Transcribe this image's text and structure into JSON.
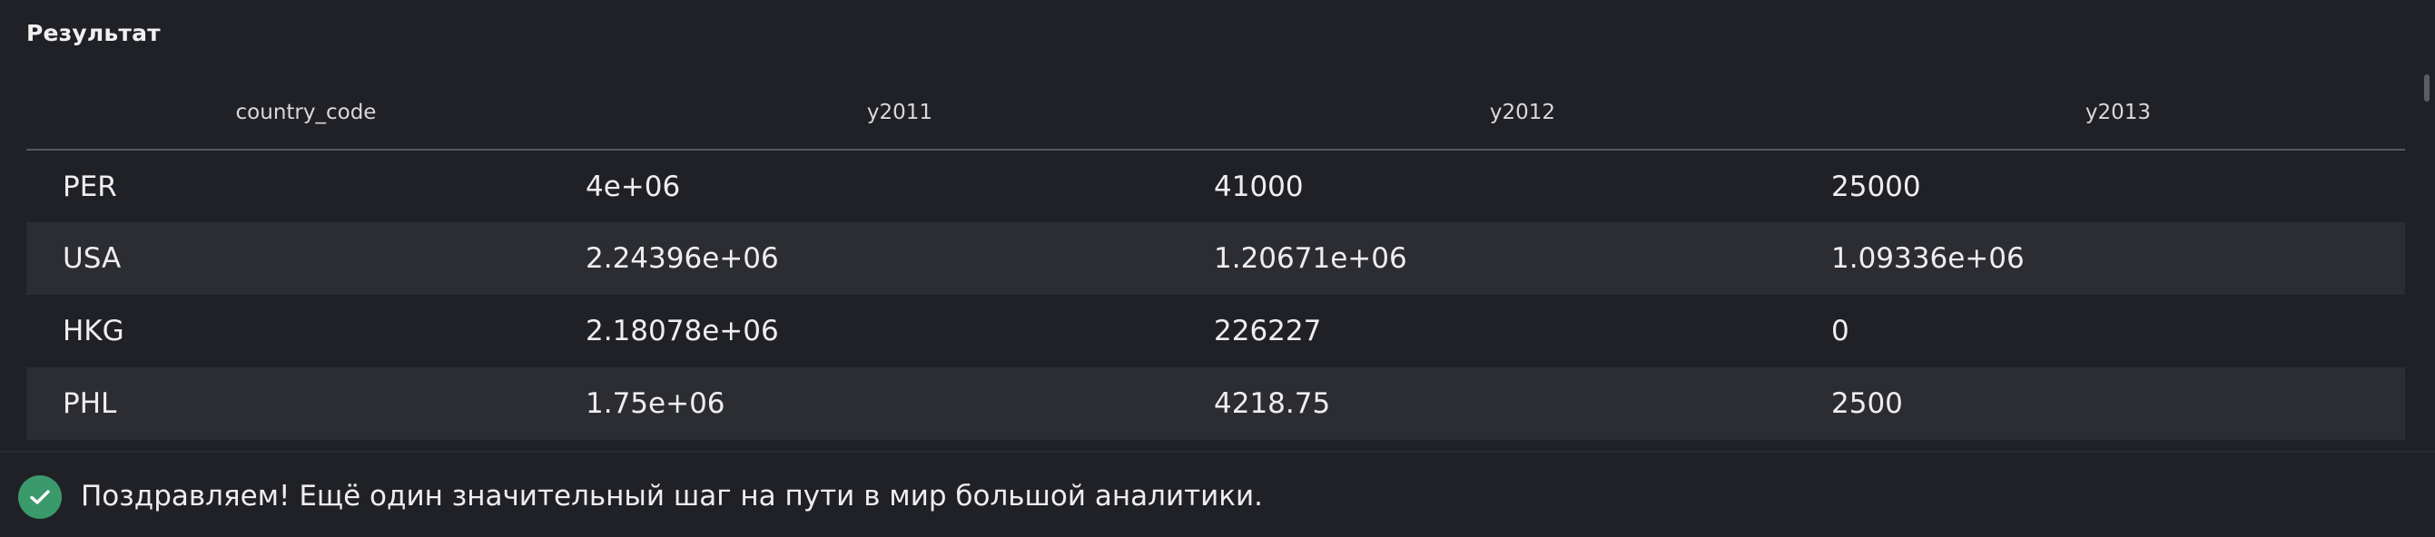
{
  "result": {
    "title": "Результат",
    "columns": [
      "country_code",
      "y2011",
      "y2012",
      "y2013"
    ],
    "rows": [
      [
        "PER",
        "4e+06",
        "41000",
        "25000"
      ],
      [
        "USA",
        "2.24396e+06",
        "1.20671e+06",
        "1.09336e+06"
      ],
      [
        "HKG",
        "2.18078e+06",
        "226227",
        "0"
      ],
      [
        "PHL",
        "1.75e+06",
        "4218.75",
        "2500"
      ]
    ]
  },
  "status": {
    "icon": "check-circle-icon",
    "message": "Поздравляем! Ещё один значительный шаг на пути в мир большой аналитики.",
    "color": "#3a9a6c"
  }
}
